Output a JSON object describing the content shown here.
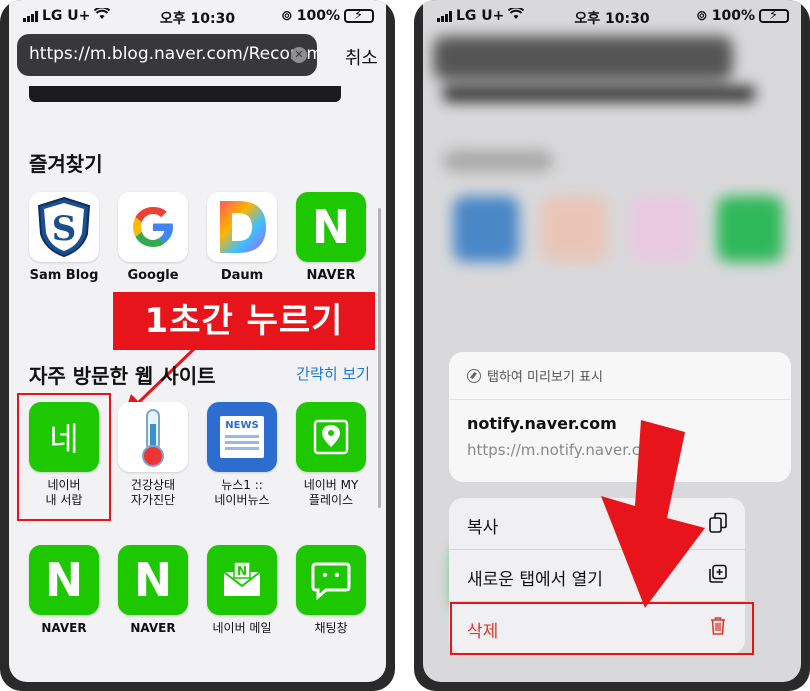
{
  "status": {
    "carrier": "LG U+",
    "time": "오후 10:30",
    "battery": "100%"
  },
  "left": {
    "url": "https://m.blog.naver.com/Recomm",
    "cancel_label": "취소",
    "favorites_title": "즐겨찾기",
    "favorites": [
      {
        "label": "Sam Blog",
        "icon": "shield-s-icon"
      },
      {
        "label": "Google",
        "icon": "google-g-icon"
      },
      {
        "label": "Daum",
        "icon": "daum-d-icon"
      },
      {
        "label": "NAVER",
        "icon": "naver-n-icon"
      }
    ],
    "hint": "1초간 누르기",
    "frequent_title": "자주 방문한 웹 사이트",
    "simple_view": "간략히 보기",
    "frequent": [
      {
        "label1": "네이버",
        "label2": "내 서랍",
        "icon_text": "네"
      },
      {
        "label1": "건강상태",
        "label2": "자가진단",
        "icon": "thermometer-icon"
      },
      {
        "label1": "뉴스1 ::",
        "label2": "네이버뉴스",
        "icon_text": "NEWS"
      },
      {
        "label1": "네이버 MY",
        "label2": "플레이스",
        "icon": "map-pin-icon"
      }
    ],
    "row3": [
      {
        "label": "NAVER",
        "icon_text": "N"
      },
      {
        "label": "NAVER",
        "icon_text": "N"
      },
      {
        "label": "네이버 메일",
        "icon": "mail-icon"
      },
      {
        "label": "채팅창",
        "icon": "chat-icon"
      }
    ]
  },
  "right": {
    "preview_hint": "탭하여 미리보기 표시",
    "preview_title": "notify.naver.com",
    "preview_url": "https://m.notify.naver.com",
    "menu": [
      {
        "label": "복사",
        "icon": "copy-icon"
      },
      {
        "label": "새로운 탭에서 열기",
        "icon": "new-tab-icon"
      },
      {
        "label": "삭제",
        "icon": "trash-icon"
      }
    ]
  },
  "colors": {
    "accent_red": "#e8141b",
    "naver_green": "#1ec800",
    "link_blue": "#1a7ad9",
    "danger": "#e5342b"
  }
}
